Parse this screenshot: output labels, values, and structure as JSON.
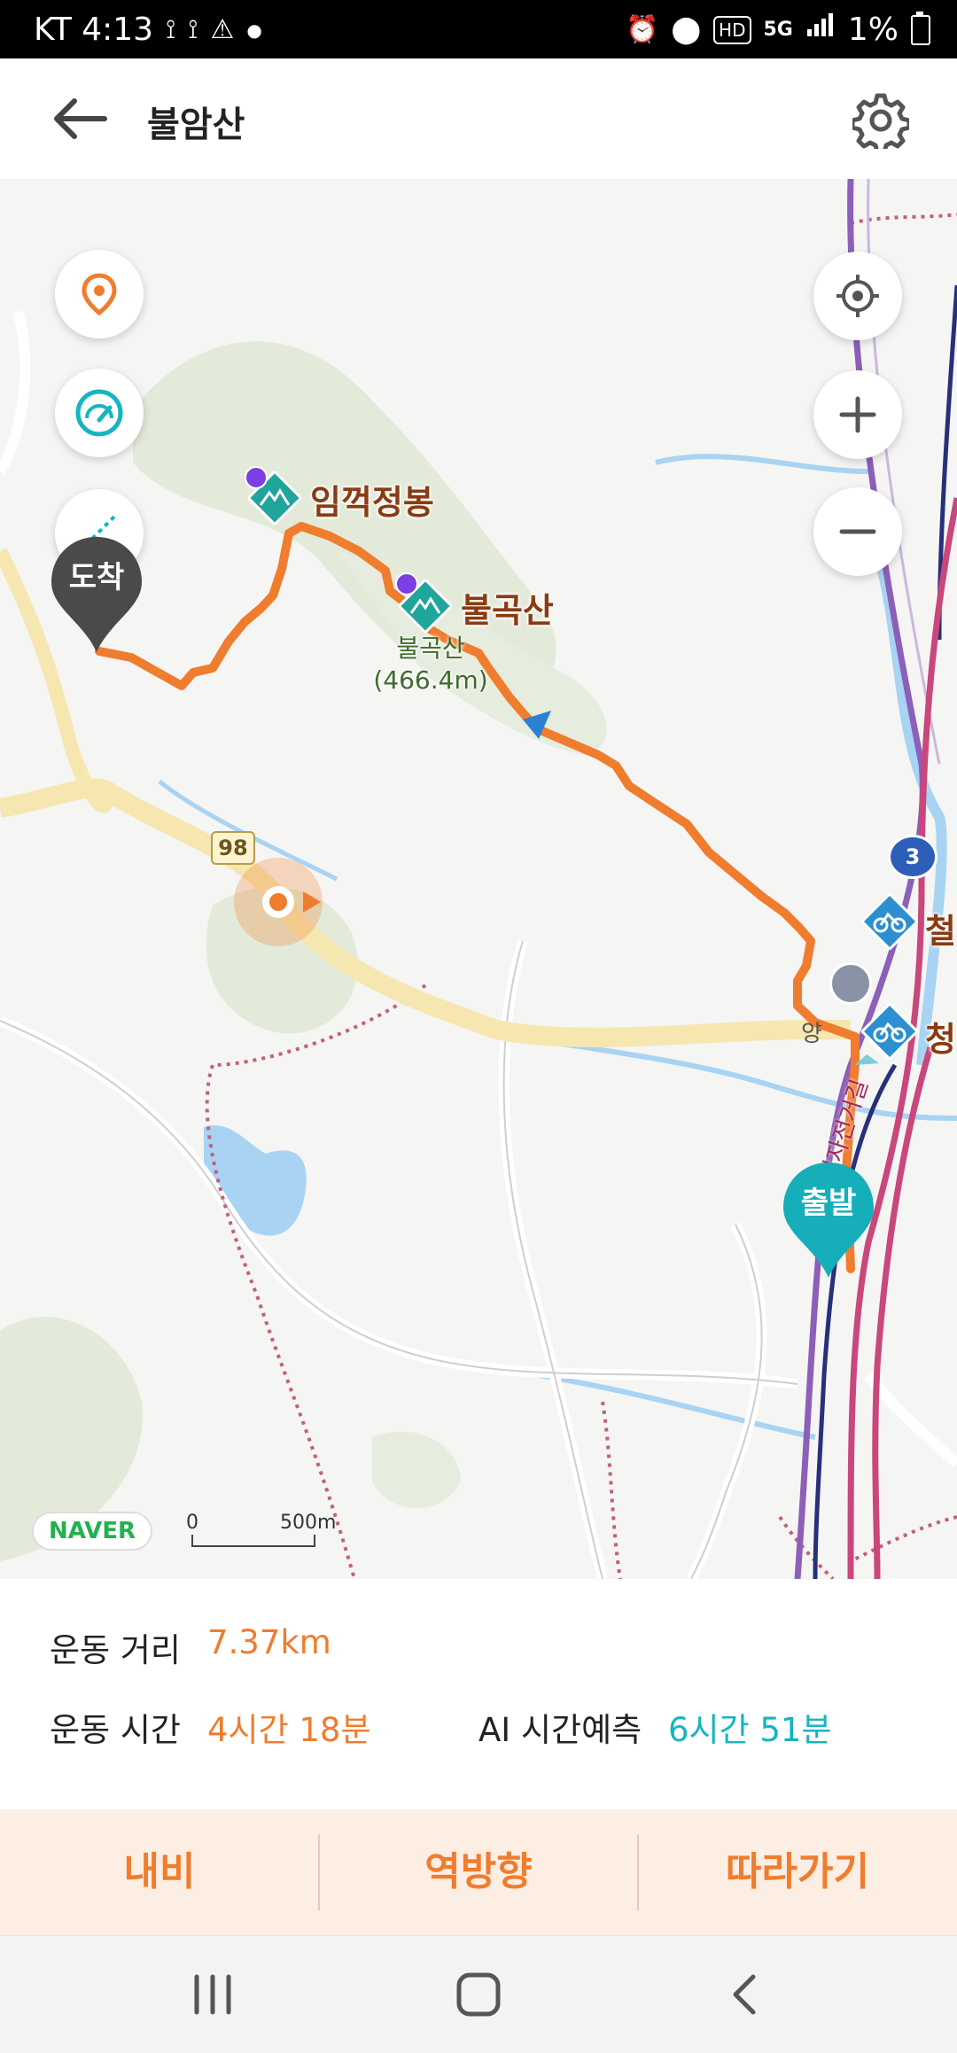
{
  "status_bar": {
    "carrier_time": "KT 4:13",
    "battery_pct": "1%",
    "network": "5G",
    "hd": "HD",
    "icons": [
      "shoe-icon",
      "shoe-icon",
      "warning-icon",
      "dot-icon",
      "alarm-icon",
      "location-icon",
      "hd-icon",
      "5g-icon",
      "signal-icon",
      "battery-icon"
    ]
  },
  "header": {
    "title": "불암산",
    "back_icon": "arrow-left-icon",
    "settings_icon": "gear-icon"
  },
  "map": {
    "peaks": [
      {
        "name": "임꺽정봉"
      },
      {
        "name": "불곡산"
      }
    ],
    "peak_info": {
      "name": "불곡산",
      "elevation": "(466.4m)"
    },
    "right_labels": [
      "철",
      "청"
    ],
    "road_number": "98",
    "route_badge": "3",
    "station_label": "양",
    "bike_road_label": "중랑천자전거길",
    "pin_start": "출발",
    "pin_end": "도착",
    "provider": "NAVER",
    "scale_start": "0",
    "scale_end": "500m",
    "route_color": "#f07c2e",
    "left_buttons": [
      "location-pin-icon",
      "speedometer-icon",
      "slope-icon"
    ],
    "right_buttons": [
      "my-location-icon",
      "zoom-in-icon",
      "zoom-out-icon"
    ]
  },
  "summary": {
    "distance_label": "운동 거리",
    "distance_value": "7.37km",
    "time_label": "운동 시간",
    "time_value": "4시간 18분",
    "ai_label": "AI 시간예측",
    "ai_value": "6시간 51분"
  },
  "actions": {
    "navi": "내비",
    "reverse": "역방향",
    "follow": "따라가기"
  },
  "colors": {
    "accent": "#f07c2e",
    "teal": "#16b5c0",
    "action_bg": "#fdeee3"
  }
}
